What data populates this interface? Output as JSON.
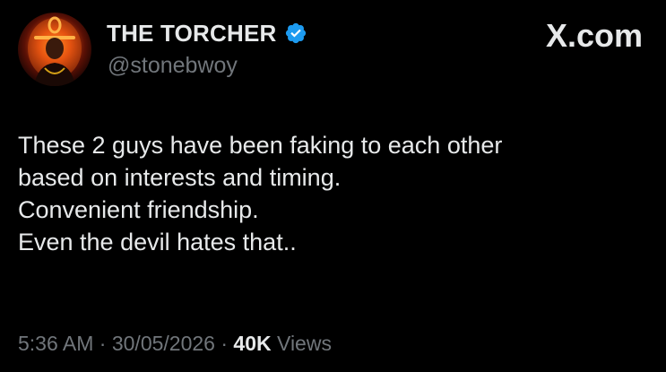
{
  "author": {
    "display_name": "THE TORCHER",
    "handle": "@stonebwoy",
    "verified": true
  },
  "brand": {
    "label": "X.com"
  },
  "tweet": {
    "lines": [
      "These 2 guys have been faking to each other",
      "based on interests and timing.",
      "Convenient friendship.",
      "Even the devil hates that.."
    ]
  },
  "meta": {
    "time": "5:36 AM",
    "separator": "·",
    "date": "30/05/2026",
    "views_count": "40K",
    "views_label": "Views"
  },
  "colors": {
    "background": "#000000",
    "primary_text": "#e7e9ea",
    "secondary_text": "#71767b",
    "verified_badge": "#1d9bf0"
  },
  "icons": {
    "verified": "verified-badge-icon",
    "avatar": "avatar-image"
  }
}
